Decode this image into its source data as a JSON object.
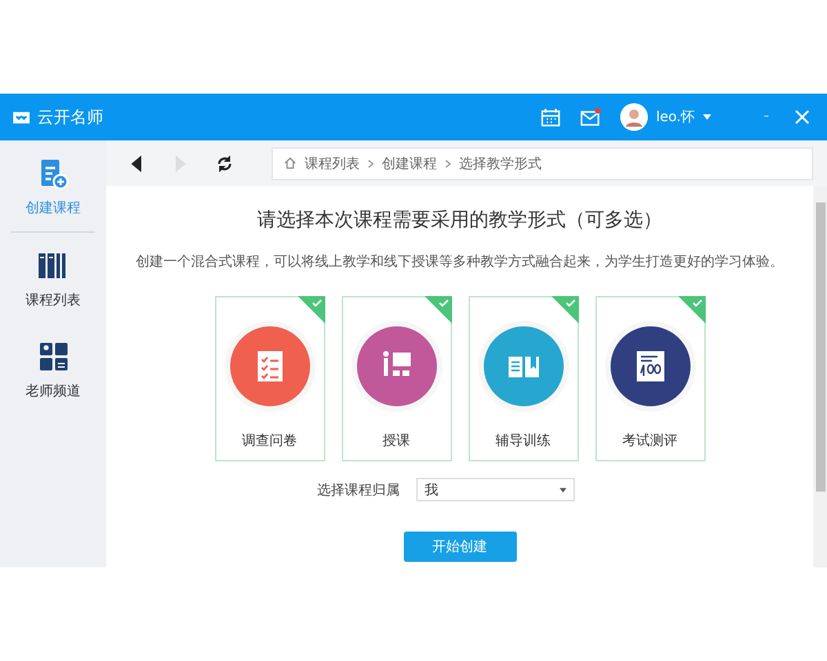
{
  "header": {
    "app_name": "云开名师",
    "user_name": "leo.怀",
    "mail_unread": true
  },
  "sidebar": {
    "items": [
      {
        "label": "创建课程",
        "kind": "create",
        "selected": true
      },
      {
        "label": "课程列表",
        "kind": "list",
        "selected": false
      },
      {
        "label": "老师频道",
        "kind": "teachers",
        "selected": false
      }
    ]
  },
  "toolbar": {
    "nav": [
      {
        "kind": "back",
        "disabled": false
      },
      {
        "kind": "forward",
        "disabled": true
      },
      {
        "kind": "refresh",
        "disabled": false
      }
    ],
    "breadcrumb": [
      "课程列表",
      "创建课程",
      "选择教学形式"
    ]
  },
  "page": {
    "title": "请选择本次课程需要采用的教学形式（可多选）",
    "subtitle": "创建一个混合式课程，可以将线上教学和线下授课等多种教学方式融合起来，为学生打造更好的学习体验。",
    "forms": [
      {
        "label": "调查问卷",
        "kind": "survey",
        "color": "#f0604f",
        "checked": true
      },
      {
        "label": "授课",
        "kind": "lecture",
        "color": "#c0589a",
        "checked": true
      },
      {
        "label": "辅导训练",
        "kind": "training",
        "color": "#27a6d0",
        "checked": true
      },
      {
        "label": "考试测评",
        "kind": "exam",
        "color": "#2f3f7f",
        "checked": true
      }
    ],
    "owner_field": {
      "label": "选择课程归属",
      "value": "我"
    },
    "create_button": "开始创建"
  }
}
